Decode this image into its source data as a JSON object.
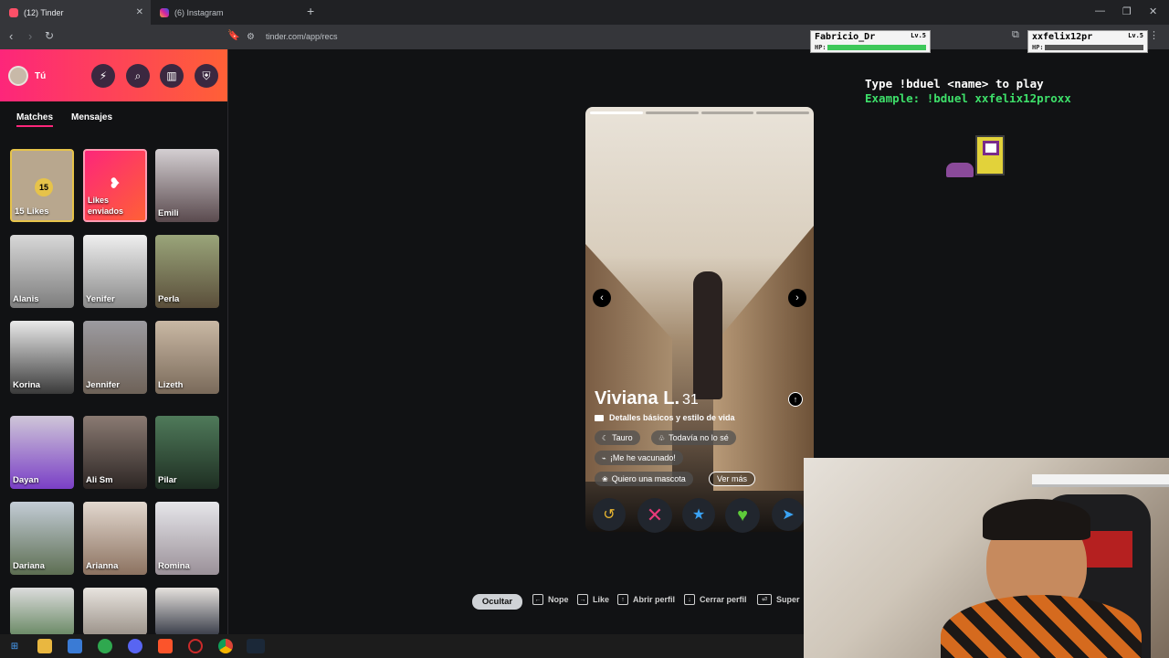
{
  "browser": {
    "tabs": [
      {
        "label": "(12) Tinder",
        "active": true
      },
      {
        "label": "(6) Instagram",
        "active": false
      }
    ],
    "url": "tinder.com/app/recs"
  },
  "sidebar": {
    "me_label": "Tú",
    "tabs": [
      "Matches",
      "Mensajes"
    ],
    "likes_count": "15",
    "likes_label": "15 Likes",
    "sent_label": "Likes enviados",
    "matches": [
      "Emili",
      "Alanis",
      "Yenifer",
      "Perla",
      "Korina",
      "Jennifer",
      "Lizeth",
      "Dayan",
      "Ali Sm",
      "Pilar",
      "Dariana",
      "Arianna",
      "Romina"
    ]
  },
  "profile": {
    "name": "Viviana L.",
    "age": "31",
    "details_heading": "Detalles básicos y estilo de vida",
    "chips": [
      "Tauro",
      "Todavía no lo sé",
      "¡Me he vacunado!",
      "Quiero una mascota"
    ],
    "see_more": "Ver más",
    "photos_total": 4,
    "photo_current": 1
  },
  "shortcuts": {
    "hide": "Ocultar",
    "nope": "Nope",
    "like": "Like",
    "open": "Abrir perfil",
    "close": "Cerrar perfil",
    "super": "Super"
  },
  "overlay": {
    "player1": {
      "name": "Fabricio_Dr",
      "level": "Lv.5",
      "hp_label": "HP:",
      "hp": 1.0
    },
    "player2": {
      "name": "xxfelix12pr",
      "level": "Lv.5",
      "hp_label": "HP:",
      "hp": 0.0
    },
    "duel_line1": "Type !bduel <name> to play",
    "duel_line2": "Example: !bduel xxfelix12proxx"
  },
  "colors": {
    "brand_gradient_start": "#fd267a",
    "brand_gradient_end": "#ff6036",
    "nope": "#e83a79",
    "superlike": "#3aa3f5",
    "like": "#5ecb3a",
    "rewind": "#e8b530",
    "boost": "#3aa3f5"
  }
}
